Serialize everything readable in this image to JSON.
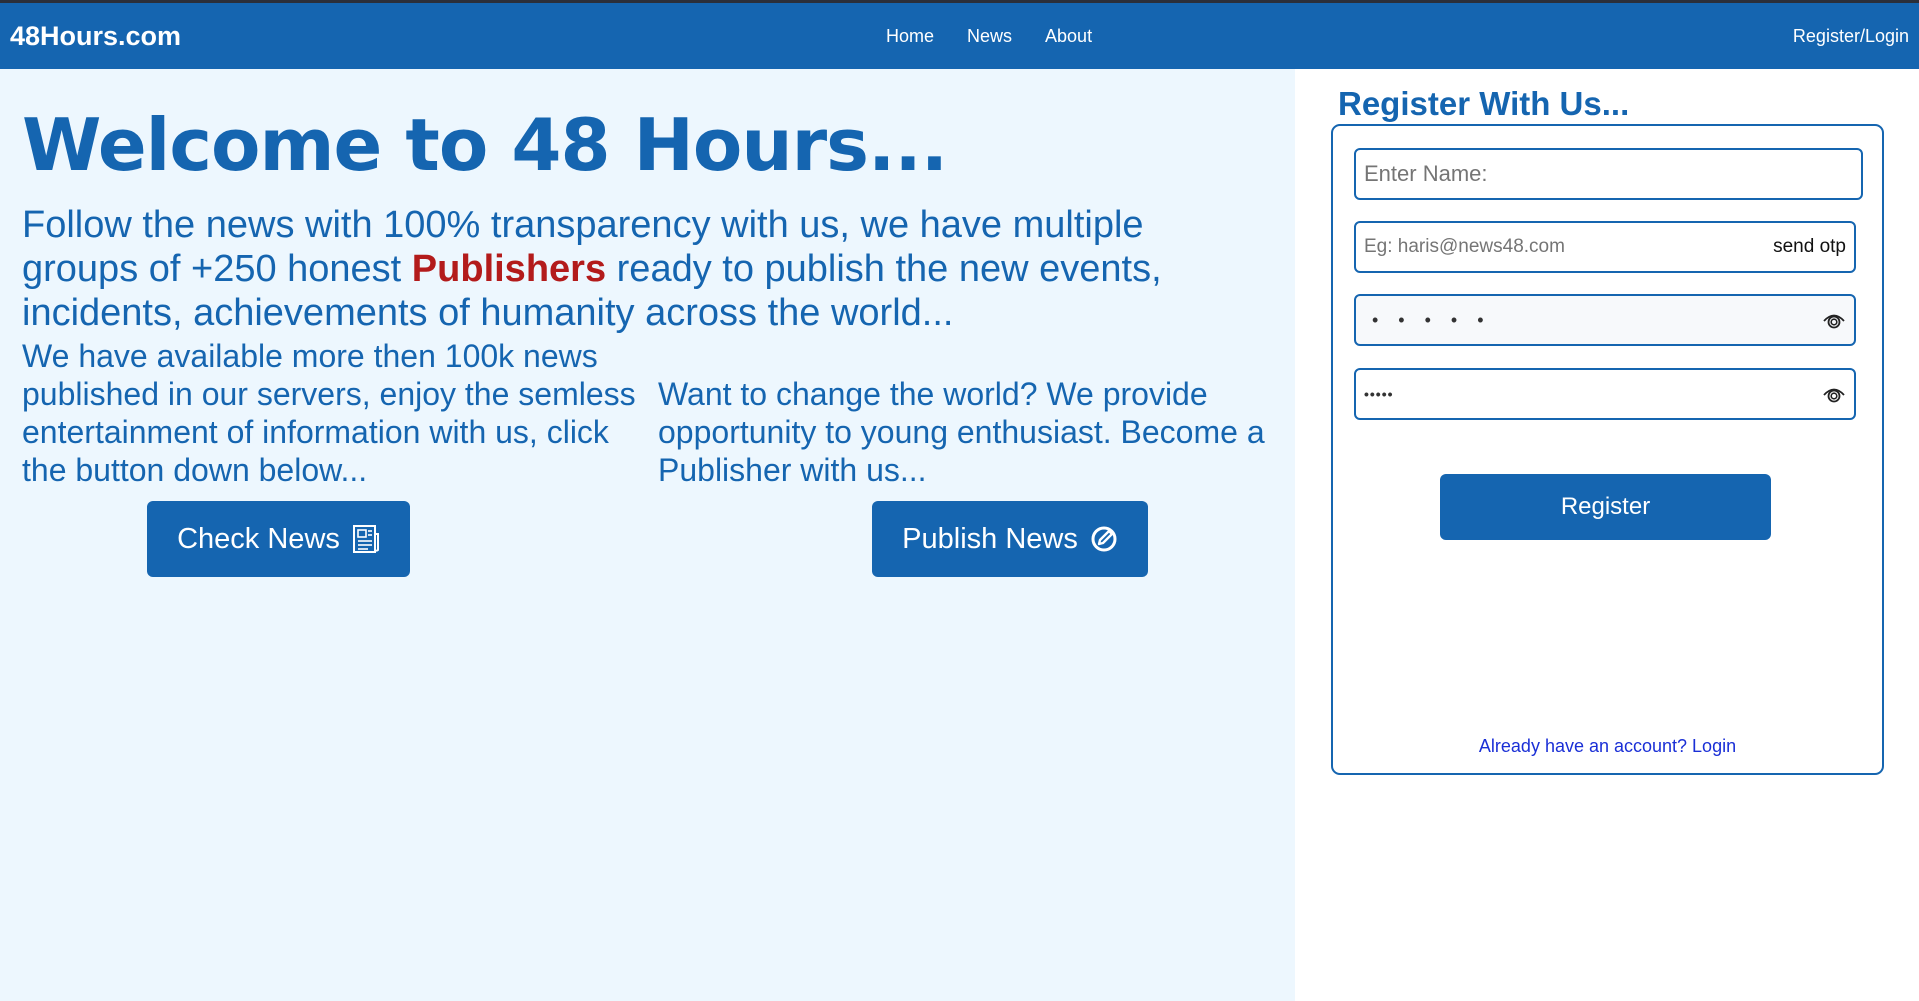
{
  "nav": {
    "brand": "48Hours.com",
    "links": [
      "Home",
      "News",
      "About"
    ],
    "register_login": "Register/Login"
  },
  "hero": {
    "title": "Welcome to 48 Hours...",
    "intro_before": "Follow the news with 100% transparency with us, we have multiple groups of +250 honest ",
    "intro_highlight": "Publishers",
    "intro_after": " ready to publish the new events, incidents, achievements of humanity across the world...",
    "col_left": "We have available more then 100k news published in our servers, enjoy the semless entertainment of information with us, click the button down below...",
    "col_right": "Want to change the world? We provide opportunity to young enthusiast. Become a Publisher with us...",
    "check_button": "Check News",
    "publish_button": "Publish News"
  },
  "register": {
    "title": "Register With Us...",
    "name_placeholder": "Enter Name:",
    "email_placeholder": "Eg: haris@news48.com",
    "send_otp": "send otp",
    "password_mask": "•••••",
    "confirm_mask": "•••••",
    "button": "Register",
    "login_link": "Already have an account? Login"
  },
  "colors": {
    "primary": "#1565b0",
    "highlight": "#b31b1b",
    "left_bg": "#edf7fe",
    "link": "#1a2fd6"
  }
}
